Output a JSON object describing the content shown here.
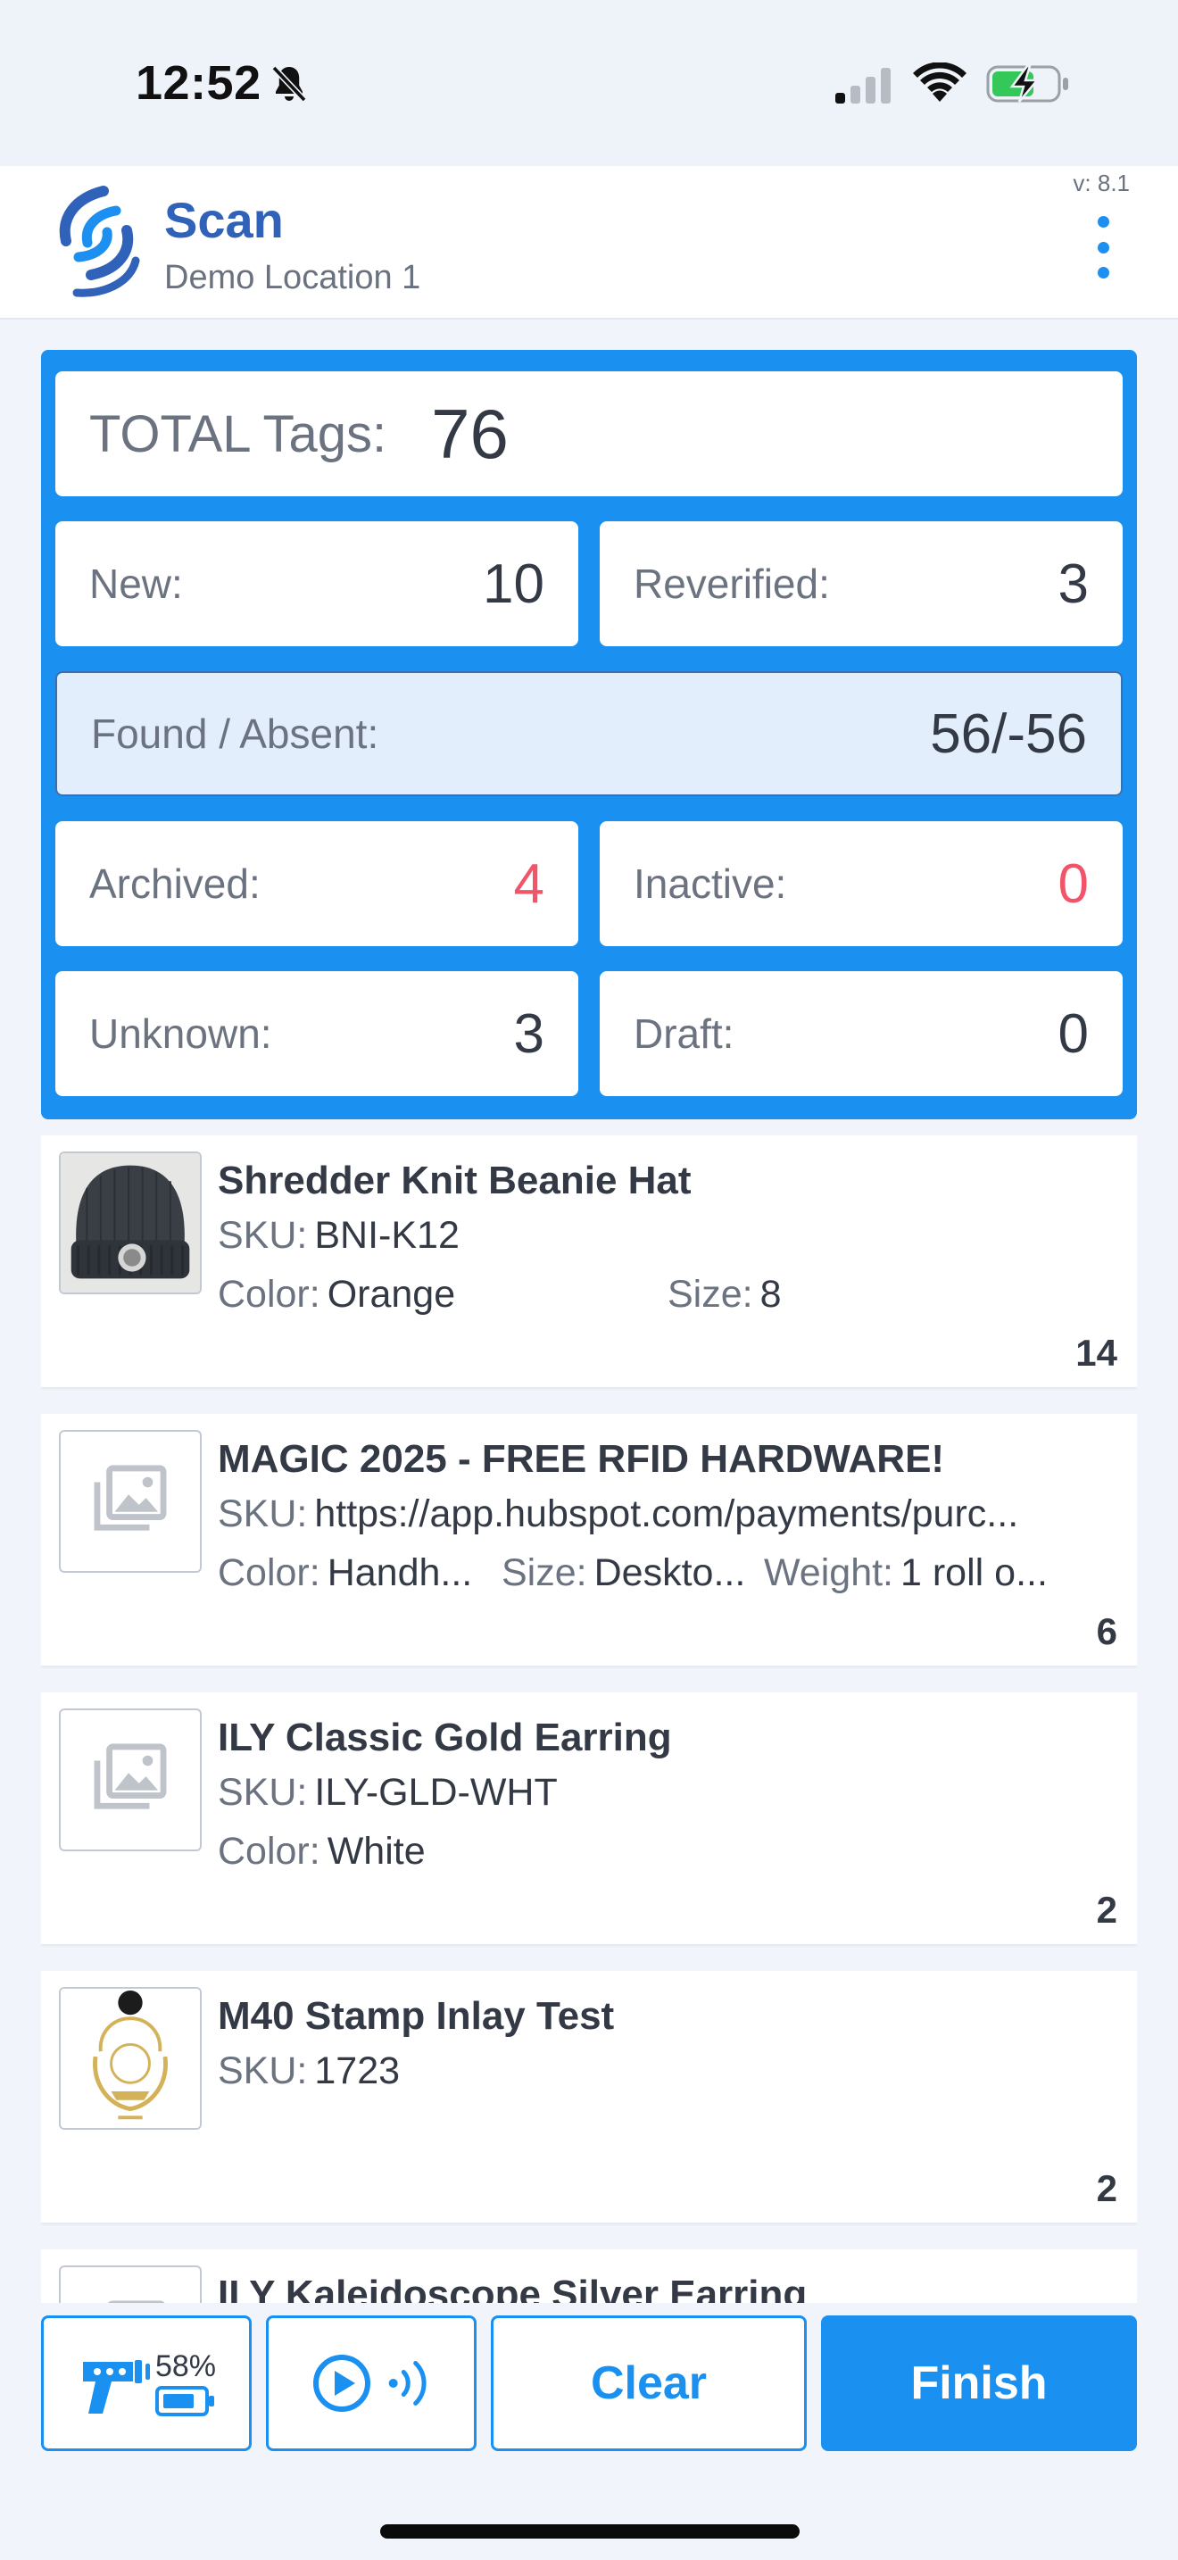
{
  "status_bar": {
    "time": "12:52",
    "battery_charging": true,
    "battery_color": "#34c759"
  },
  "header": {
    "title": "Scan",
    "location": "Demo Location 1",
    "version": "v: 8.1",
    "brand_color": "#2f62b8",
    "logo_icon": "brand-swirl-logo",
    "menu_icon": "more-vertical-icon"
  },
  "stats": {
    "panel_color": "#1a90f0",
    "total_label": "TOTAL Tags:",
    "total_value": "76",
    "new_label": "New:",
    "new_value": "10",
    "reverified_label": "Reverified:",
    "reverified_value": "3",
    "found_label": "Found / Absent:",
    "found_value": "56/-56",
    "archived_label": "Archived:",
    "archived_value": "4",
    "inactive_label": "Inactive:",
    "inactive_value": "0",
    "unknown_label": "Unknown:",
    "unknown_value": "3",
    "draft_label": "Draft:",
    "draft_value": "0",
    "alert_color": "#f2546a"
  },
  "items": [
    {
      "name": "Shredder Knit Beanie Hat",
      "sku_label": "SKU:",
      "sku": "BNI-K12",
      "color_label": "Color:",
      "color": "Orange",
      "size_label": "Size:",
      "size": "8",
      "count": "14",
      "thumb": "beanie-photo"
    },
    {
      "name": "MAGIC 2025 - FREE RFID HARDWARE!",
      "sku_label": "SKU:",
      "sku": "https://app.hubspot.com/payments/purc...",
      "color_label": "Color:",
      "color": "Handh...",
      "size_label": "Size:",
      "size": "Deskto...",
      "weight_label": "Weight:",
      "weight": "1 roll o...",
      "count": "6",
      "thumb": "image-placeholder-icon"
    },
    {
      "name": "ILY Classic Gold Earring",
      "sku_label": "SKU:",
      "sku": "ILY-GLD-WHT",
      "color_label": "Color:",
      "color": "White",
      "count": "2",
      "thumb": "image-placeholder-icon"
    },
    {
      "name": "M40 Stamp Inlay Test",
      "sku_label": "SKU:",
      "sku": "1723",
      "count": "2",
      "thumb": "crest-photo"
    },
    {
      "name": "ILY Kaleidoscope Silver Earring",
      "thumb": "image-placeholder-icon"
    }
  ],
  "bottom_bar": {
    "reader_battery": "58%",
    "reader_icon": "rfid-reader-gun-icon",
    "scan_icon": "play-circle-icon",
    "signal_icon": "rfid-signal-icon",
    "clear_label": "Clear",
    "finish_label": "Finish",
    "accent_color": "#1a90f0"
  }
}
